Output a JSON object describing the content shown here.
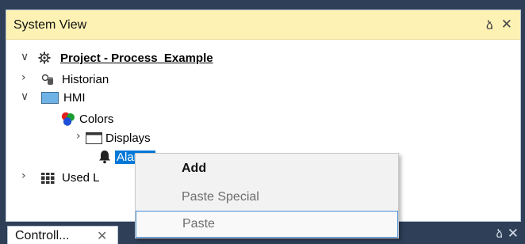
{
  "panel": {
    "title": "System View",
    "pin_glyph": "ձ",
    "close_glyph": "✕"
  },
  "tree": {
    "items": [
      {
        "label": "Project - Process_Example",
        "expander": "∨",
        "icon": "gear-icon"
      },
      {
        "label": "Historian",
        "expander": "›",
        "icon": "database-icon"
      },
      {
        "label": "HMI",
        "expander": "∨",
        "icon": "monitor-icon"
      },
      {
        "label": "Colors",
        "expander": "",
        "icon": "rgb-colors-icon"
      },
      {
        "label": "Displays",
        "expander": "›",
        "icon": "window-icon"
      },
      {
        "label": "Alarms",
        "expander": "",
        "icon": "bell-icon"
      },
      {
        "label": "Used L",
        "expander": "›",
        "icon": "library-icon"
      }
    ]
  },
  "context_menu": {
    "items": [
      {
        "label": "Add",
        "state": "enabled"
      },
      {
        "label": "Paste Special",
        "state": "disabled"
      },
      {
        "label": "Paste",
        "state": "disabled-hover"
      }
    ]
  },
  "bottom_tabs": {
    "active_label": "Controll...",
    "close_glyph": "✕",
    "pin_glyph": "ձ",
    "strip_close_glyph": "✕"
  },
  "colors": {
    "header_bg": "#fdf1b4",
    "selection": "#0078d7",
    "background": "#2e3f57"
  }
}
